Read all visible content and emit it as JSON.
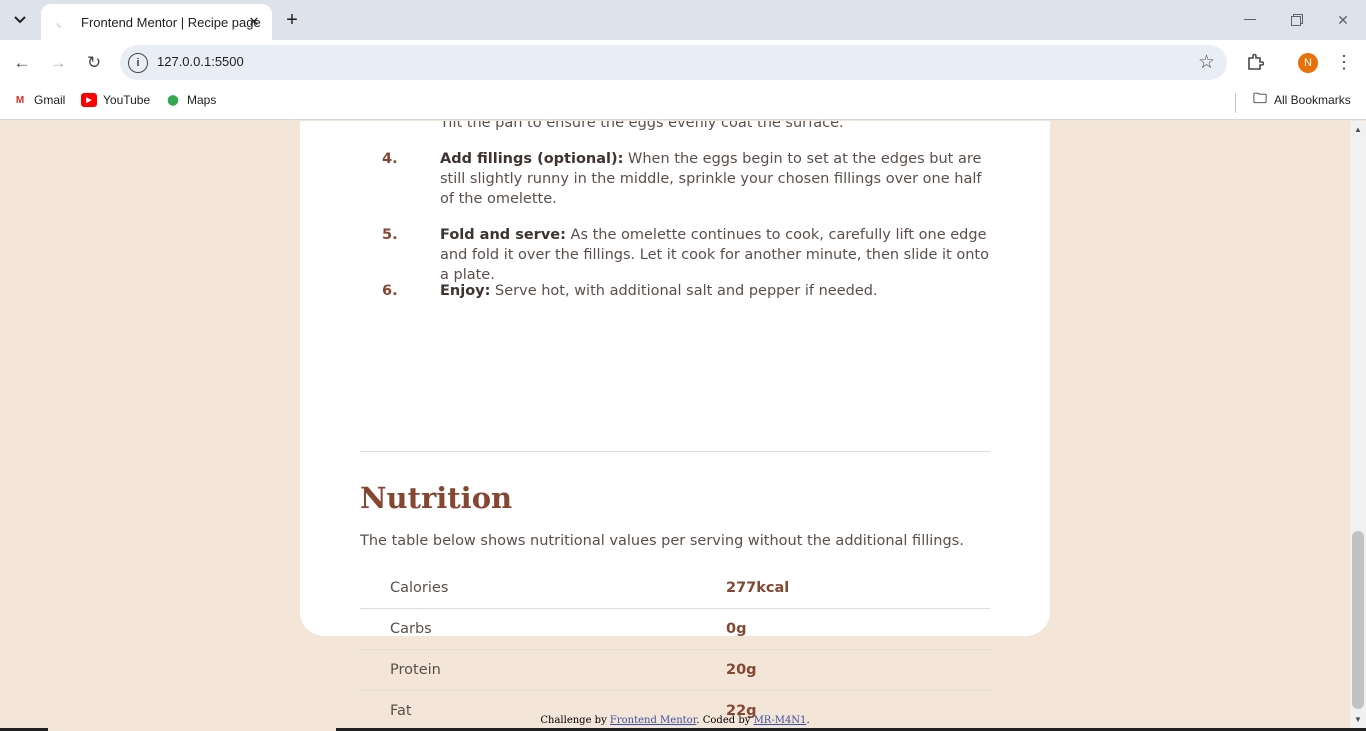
{
  "browser": {
    "tab_title": "Frontend Mentor | Recipe page",
    "url": "127.0.0.1:5500",
    "profile_initial": "N",
    "bookmarks": [
      {
        "label": "Gmail",
        "icon": "gmail-icon"
      },
      {
        "label": "YouTube",
        "icon": "youtube-icon"
      },
      {
        "label": "Maps",
        "icon": "maps-icon"
      }
    ],
    "all_bookmarks": "All Bookmarks"
  },
  "recipe": {
    "step3_tail": "Tilt the pan to ensure the eggs evenly coat the surface.",
    "steps": [
      {
        "num": "4.",
        "title": "Add fillings (optional):",
        "text": " When the eggs begin to set at the edges but are still slightly runny in the middle, sprinkle your chosen fillings over one half of the omelette."
      },
      {
        "num": "5.",
        "title": "Fold and serve:",
        "text": " As the omelette continues to cook, carefully lift one edge and fold it over the fillings. Let it cook for another minute, then slide it onto a plate."
      },
      {
        "num": "6.",
        "title": "Enjoy:",
        "text": " Serve hot, with additional salt and pepper if needed."
      }
    ],
    "nutrition": {
      "title": "Nutrition",
      "description": "The table below shows nutritional values per serving without the additional fillings.",
      "rows": [
        {
          "label": "Calories",
          "value": "277kcal"
        },
        {
          "label": "Carbs",
          "value": "0g"
        },
        {
          "label": "Protein",
          "value": "20g"
        },
        {
          "label": "Fat",
          "value": "22g"
        }
      ]
    }
  },
  "footer": {
    "prefix": "Challenge by ",
    "link1": "Frontend Mentor",
    "middle": ". Coded by ",
    "link2": "MR-M4N1",
    "suffix": "."
  },
  "colors": {
    "page_bg": "#f3e5d8",
    "accent": "#854632",
    "card_bg": "#ffffff"
  }
}
